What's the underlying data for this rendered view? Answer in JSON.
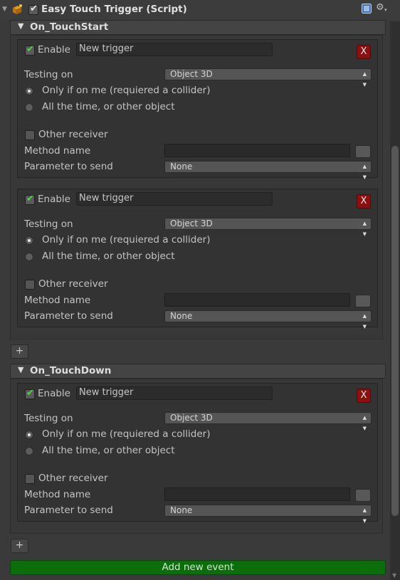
{
  "component": {
    "title": "Easy Touch Trigger (Script)",
    "enabled": true,
    "icons": [
      "fold-arrow-icon",
      "script-component-icon",
      "help-icon",
      "gear-icon"
    ]
  },
  "sections": [
    {
      "title": "On_TouchStart",
      "triggers": [
        {
          "enable_label": "Enable",
          "name": "New trigger",
          "delete_label": "X",
          "testing_label": "Testing on",
          "testing_value": "Object 3D",
          "radio_1": "Only if on me (requiered a collider)",
          "radio_2": "All the time, or other object",
          "other_receiver_label": "Other receiver",
          "method_label": "Method name",
          "method_value": "",
          "param_label": "Parameter to send",
          "param_value": "None"
        },
        {
          "enable_label": "Enable",
          "name": "New trigger",
          "delete_label": "X",
          "testing_label": "Testing on",
          "testing_value": "Object 3D",
          "radio_1": "Only if on me (requiered a collider)",
          "radio_2": "All the time, or other object",
          "other_receiver_label": "Other receiver",
          "method_label": "Method name",
          "method_value": "",
          "param_label": "Parameter to send",
          "param_value": "None"
        }
      ],
      "add_label": "+"
    },
    {
      "title": "On_TouchDown",
      "triggers": [
        {
          "enable_label": "Enable",
          "name": "New trigger",
          "delete_label": "X",
          "testing_label": "Testing on",
          "testing_value": "Object 3D",
          "radio_1": "Only if on me (requiered a collider)",
          "radio_2": "All the time, or other object",
          "other_receiver_label": "Other receiver",
          "method_label": "Method name",
          "method_value": "",
          "param_label": "Parameter to send",
          "param_value": "None"
        }
      ],
      "add_label": "+"
    }
  ],
  "add_new_event_label": "Add new event",
  "colors": {
    "background": "#3a3a3a",
    "delete_button": "#8c1010",
    "add_event_button": "#0b6d0b",
    "enable_check": "#4bd84b"
  }
}
